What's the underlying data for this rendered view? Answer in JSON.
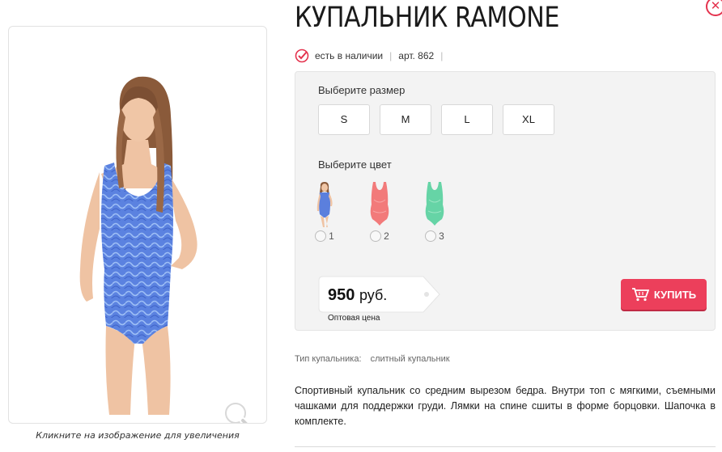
{
  "product": {
    "title": "КУПАЛЬНИК RAMONE",
    "stock": "есть в наличии",
    "sku": "арт. 862",
    "image_caption": "Кликните на изображение для увеличения"
  },
  "options": {
    "size_label": "Выберите размер",
    "sizes": [
      "S",
      "M",
      "L",
      "XL"
    ],
    "color_label": "Выберите цвет",
    "colors": [
      {
        "label": "1",
        "swatch": "#5b7fdd"
      },
      {
        "label": "2",
        "swatch": "#f27a7a"
      },
      {
        "label": "3",
        "swatch": "#66d4a6"
      }
    ]
  },
  "price": {
    "amount": "950",
    "currency": "руб.",
    "note": "Оптовая цена"
  },
  "buy_button": "КУПИТЬ",
  "details": {
    "type_label": "Тип купальника:",
    "type_value": "слитный купальник",
    "description": "Спортивный купальник со средним вырезом бедра. Внутри топ с мягкими, съемными чашками для поддержки груди. Лямки на спине сшиты в форме борцовки. Шапочка в комплекте."
  },
  "colors": {
    "accent": "#ec3f5b",
    "panel": "#f3f3f3"
  },
  "icons": [
    "close-icon",
    "check-icon",
    "zoom-icon",
    "cart-icon"
  ]
}
